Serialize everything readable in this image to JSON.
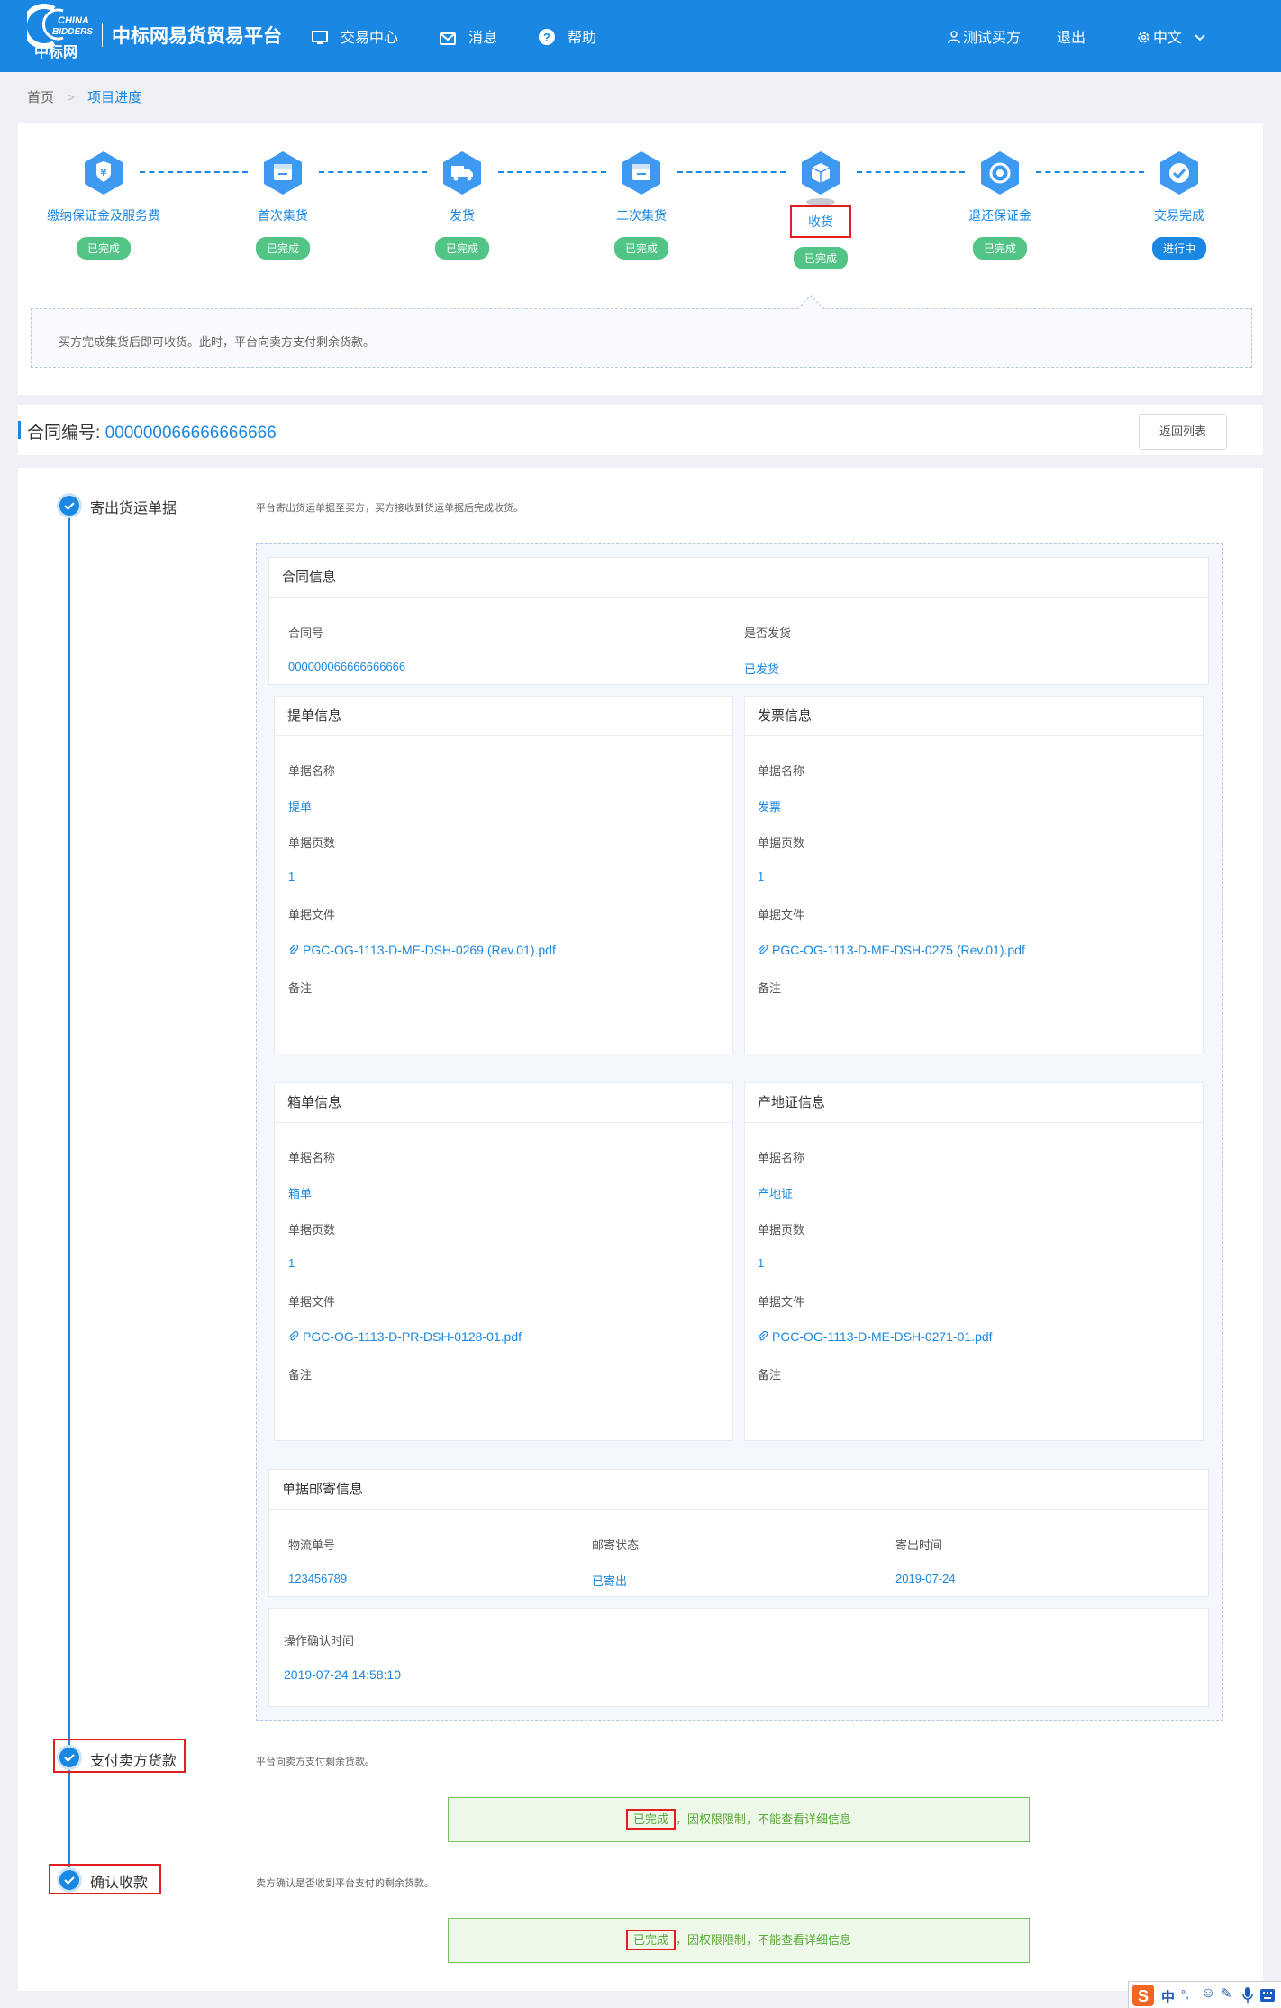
{
  "header": {
    "logo_text": "CHINA BIDDERS",
    "logo_cn": "中标网",
    "brand": "中标网易货贸易平台",
    "nav": [
      {
        "label": "交易中心",
        "icon": "monitor-icon"
      },
      {
        "label": "消息",
        "icon": "mail-icon"
      },
      {
        "label": "帮助",
        "icon": "help-icon"
      }
    ],
    "user": "测试买方",
    "logout": "退出",
    "language": "中文"
  },
  "breadcrumb": {
    "home": "首页",
    "current": "项目进度"
  },
  "steps": [
    {
      "label": "缴纳保证金及服务费",
      "status": "已完成"
    },
    {
      "label": "首次集货",
      "status": "已完成"
    },
    {
      "label": "发货",
      "status": "已完成"
    },
    {
      "label": "二次集货",
      "status": "已完成"
    },
    {
      "label": "收货",
      "status": "已完成"
    },
    {
      "label": "退还保证金",
      "status": "已完成"
    },
    {
      "label": "交易完成",
      "status": "进行中"
    }
  ],
  "step_tip": "买方完成集货后即可收货。此时，平台向卖方支付剩余货款。",
  "contract": {
    "label": "合同编号:",
    "number": "000000066666666666",
    "back_button": "返回列表"
  },
  "sections": {
    "send_docs": {
      "title": "寄出货运单据",
      "desc": "平台寄出货运单据至买方，买方接收到货运单据后完成收货。"
    },
    "pay_seller": {
      "title": "支付卖方货款",
      "desc": "平台向卖方支付剩余货款。",
      "result_done": "已完成",
      "result_rest": "，因权限限制，不能查看详细信息"
    },
    "confirm_receipt": {
      "title": "确认收款",
      "desc": "卖方确认是否收到平台支付的剩余货款。",
      "result_done": "已完成",
      "result_rest": "，因权限限制，不能查看详细信息"
    }
  },
  "contract_info": {
    "title": "合同信息",
    "contract_no_label": "合同号",
    "contract_no": "000000066666666666",
    "shipped_label": "是否发货",
    "shipped": "已发货"
  },
  "doc_labels": {
    "name": "单据名称",
    "pages": "单据页数",
    "file": "单据文件",
    "remark": "备注"
  },
  "doc_cards": [
    {
      "title": "提单信息",
      "name": "提单",
      "pages": "1",
      "file": "PGC-OG-1113-D-ME-DSH-0269 (Rev.01).pdf"
    },
    {
      "title": "发票信息",
      "name": "发票",
      "pages": "1",
      "file": "PGC-OG-1113-D-ME-DSH-0275 (Rev.01).pdf"
    },
    {
      "title": "箱单信息",
      "name": "箱单",
      "pages": "1",
      "file": "PGC-OG-1113-D-PR-DSH-0128-01.pdf"
    },
    {
      "title": "产地证信息",
      "name": "产地证",
      "pages": "1",
      "file": "PGC-OG-1113-D-ME-DSH-0271-01.pdf"
    }
  ],
  "mail_info": {
    "title": "单据邮寄信息",
    "tracking_label": "物流单号",
    "tracking": "123456789",
    "status_label": "邮寄状态",
    "status": "已寄出",
    "date_label": "寄出时间",
    "date": "2019-07-24"
  },
  "op_confirm": {
    "label": "操作确认时间",
    "time": "2019-07-24 14:58:10"
  },
  "ime": {
    "items": [
      "中",
      "°,",
      "☺",
      "✎",
      "🎤"
    ]
  },
  "colors": {
    "primary": "#1a87e2",
    "success": "#52c486",
    "highlight": "#e02020"
  }
}
